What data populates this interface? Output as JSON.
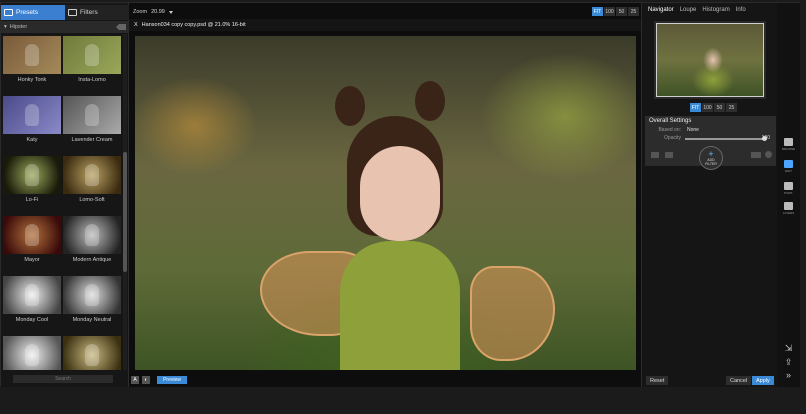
{
  "left": {
    "tabs": [
      {
        "label": "Presets",
        "active": true
      },
      {
        "label": "Filters",
        "active": false
      }
    ],
    "category": "Hipster",
    "presets": [
      {
        "name": "Honky Tonk",
        "tint": "#7a5a3a"
      },
      {
        "name": "Insta-Lomo",
        "tint": "#6f7a3a"
      },
      {
        "name": "Katy",
        "tint": "#5a5a9a"
      },
      {
        "name": "Lavender Cream",
        "tint": "#7a7a7a"
      },
      {
        "name": "Lo-Fi",
        "tint": "#4a5a2a"
      },
      {
        "name": "Lomo-Soft",
        "tint": "#6a5a30"
      },
      {
        "name": "Mayor",
        "tint": "#7a3030"
      },
      {
        "name": "Modern Antique",
        "tint": "#808080"
      },
      {
        "name": "Monday Cool",
        "tint": "#b8b8b8"
      },
      {
        "name": "Monday Neutral",
        "tint": "#a8a8a8"
      },
      {
        "name": "",
        "tint": "#c0c0c0"
      },
      {
        "name": "",
        "tint": "#9a8a5a"
      }
    ],
    "search_placeholder": "Search"
  },
  "center": {
    "zoom_label": "Zoom",
    "zoom_value": "20.99",
    "zoom_buttons": [
      "FIT",
      "100",
      "50",
      "25"
    ],
    "close_glyph": "X",
    "doc_title": "Hanson034 copy copy.psd @ 21.0% 16-bit",
    "bottom_icons": [
      "A",
      "◐"
    ],
    "preview_label": "Preview"
  },
  "right": {
    "tabs": [
      "Navigator",
      "Loupe",
      "Histogram",
      "Info"
    ],
    "nav_zoom": [
      "FIT",
      "100",
      "50",
      "25"
    ],
    "overall": {
      "title": "Overall Settings",
      "based_on_label": "Based on:",
      "based_on_value": "None",
      "opacity_label": "Opacity",
      "opacity_value": "100",
      "add_filter_line1": "ADD",
      "add_filter_line2": "FILTER"
    },
    "reset_label": "Reset",
    "cancel_label": "Cancel",
    "apply_label": "Apply"
  },
  "rail": {
    "modules": [
      {
        "label": "BROWSE",
        "icon": "browse-icon"
      },
      {
        "label": "EDIT",
        "icon": "effects-icon",
        "active": true
      },
      {
        "label": "PORT.",
        "icon": "portrait-icon"
      },
      {
        "label": "LAYERS",
        "icon": "layers-icon"
      }
    ]
  },
  "colors": {
    "accent": "#3a8ad8",
    "panel": "#151515"
  }
}
